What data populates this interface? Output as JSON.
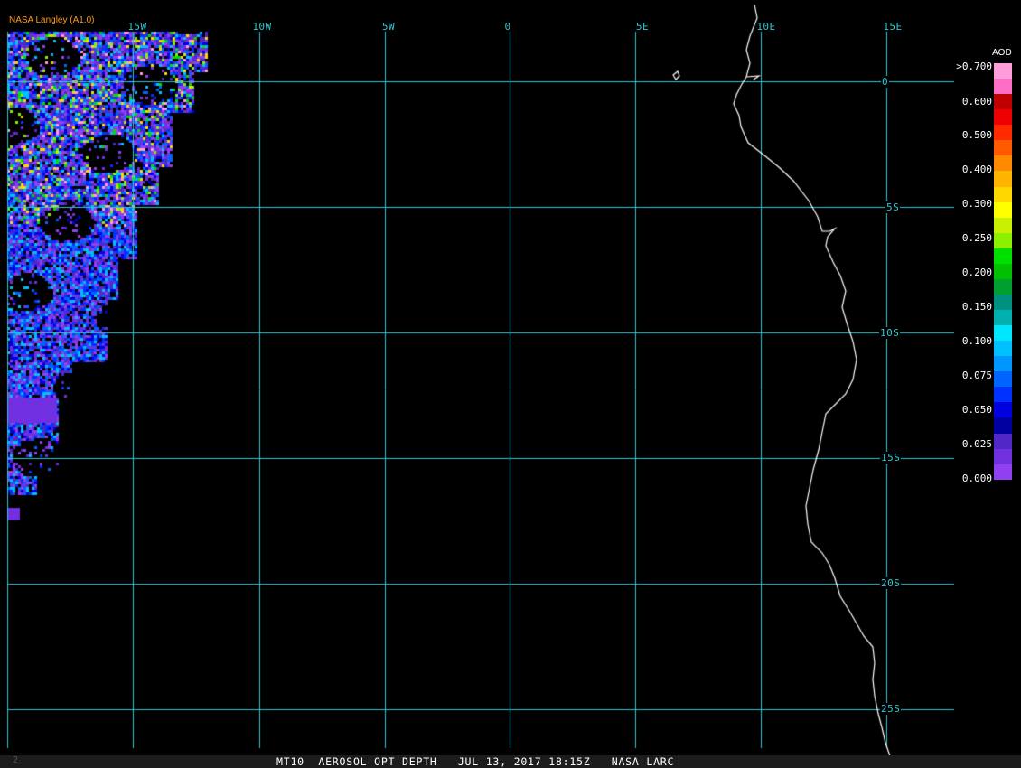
{
  "credit": "NASA Langley (A1.0)",
  "footer": {
    "left_mark": "2",
    "title": "MT10  AEROSOL OPT DEPTH   JUL 13, 2017 18:15Z   NASA LARC"
  },
  "map": {
    "projection": "cylindrical",
    "lon_range": [
      -20,
      17.5
    ],
    "lat_range": [
      2,
      -26.5
    ],
    "grid_color": "#2fc6d2",
    "coastline_color": "#ffffff",
    "lon_labels": [
      "15W",
      "10W",
      "5W",
      "0",
      "5E",
      "10E",
      "15E"
    ],
    "lat_labels": [
      "0",
      "5S",
      "10S",
      "15S",
      "20S",
      "25S"
    ]
  },
  "legend": {
    "title": "AOD",
    "ticks": [
      ">0.700",
      "0.600",
      "0.500",
      "0.400",
      "0.300",
      "0.250",
      "0.200",
      "0.150",
      "0.100",
      "0.075",
      "0.050",
      "0.025",
      "0.000"
    ],
    "colors": [
      "#ff9ed8",
      "#ff6ec6",
      "#c00000",
      "#ee0000",
      "#ff2a00",
      "#ff5a00",
      "#ff8a00",
      "#ffb400",
      "#ffd800",
      "#ffff00",
      "#c8f000",
      "#8cf000",
      "#00e000",
      "#00c000",
      "#00a030",
      "#009080",
      "#00b0b0",
      "#00e6ff",
      "#00c0ff",
      "#0096ff",
      "#0064ff",
      "#0032ff",
      "#0000e0",
      "#0000a0",
      "#5028c8",
      "#7030e0",
      "#9040f0"
    ]
  }
}
